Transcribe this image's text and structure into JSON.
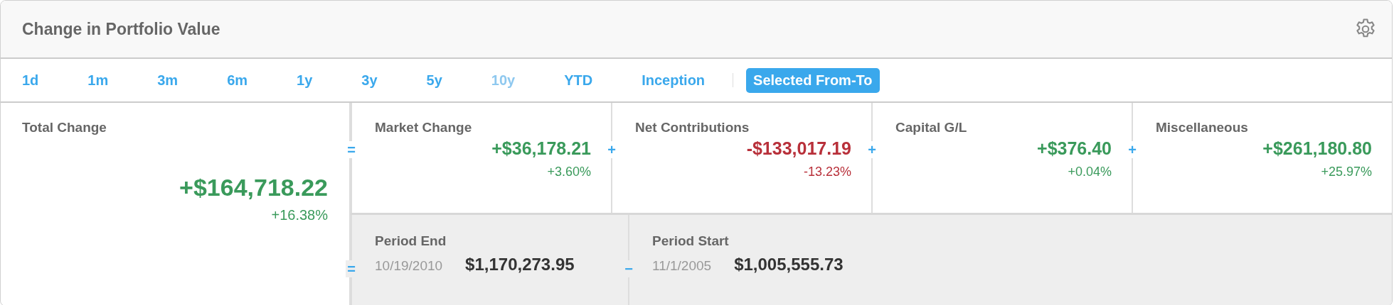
{
  "panel": {
    "title": "Change in Portfolio Value"
  },
  "tabs": [
    {
      "label": "1d",
      "selected": false,
      "disabled": false
    },
    {
      "label": "1m",
      "selected": false,
      "disabled": false
    },
    {
      "label": "3m",
      "selected": false,
      "disabled": false
    },
    {
      "label": "6m",
      "selected": false,
      "disabled": false
    },
    {
      "label": "1y",
      "selected": false,
      "disabled": false
    },
    {
      "label": "3y",
      "selected": false,
      "disabled": false
    },
    {
      "label": "5y",
      "selected": false,
      "disabled": false
    },
    {
      "label": "10y",
      "selected": false,
      "disabled": true
    },
    {
      "label": "YTD",
      "selected": false,
      "disabled": false
    },
    {
      "label": "Inception",
      "selected": false,
      "disabled": false
    },
    {
      "label": "Selected From-To",
      "selected": true,
      "disabled": false
    }
  ],
  "total": {
    "label": "Total Change",
    "value": "+$164,718.22",
    "percent": "+16.38%",
    "color": "#3a9a5b"
  },
  "components": [
    {
      "operator": "=",
      "label": "Market Change",
      "value": "+$36,178.21",
      "percent": "+3.60%",
      "color": "#3a9a5b"
    },
    {
      "operator": "+",
      "label": "Net Contributions",
      "value": "-$133,017.19",
      "percent": "-13.23%",
      "color": "#b8303a"
    },
    {
      "operator": "+",
      "label": "Capital G/L",
      "value": "+$376.40",
      "percent": "+0.04%",
      "color": "#3a9a5b"
    },
    {
      "operator": "+",
      "label": "Miscellaneous",
      "value": "+$261,180.80",
      "percent": "+25.97%",
      "color": "#3a9a5b"
    }
  ],
  "periods": [
    {
      "operator": "=",
      "label": "Period End",
      "date": "10/19/2010",
      "value": "$1,170,273.95"
    },
    {
      "operator": "−",
      "label": "Period Start",
      "date": "11/1/2005",
      "value": "$1,005,555.73"
    }
  ]
}
